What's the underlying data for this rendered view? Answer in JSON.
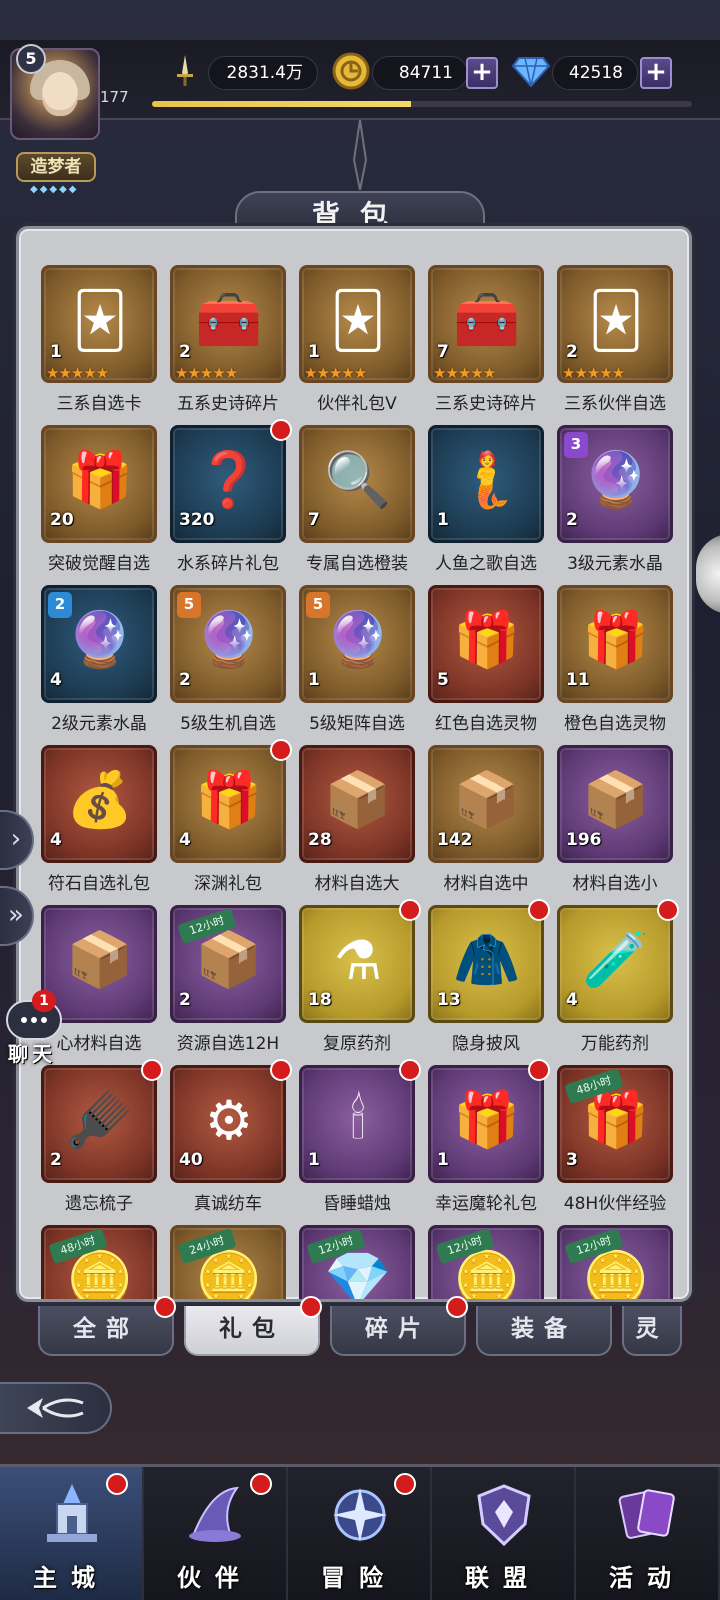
{
  "player": {
    "level": "5",
    "exp": "177",
    "exp_progress": 0.48,
    "title": "造梦者"
  },
  "resources": {
    "power": "2831.4万",
    "gold": "84711",
    "diamond": "42518"
  },
  "bag": {
    "title": "背包",
    "items": [
      {
        "label": "三系自选卡",
        "qty": "1",
        "bg": "brown",
        "icon": "card-icon",
        "glyph": "🃏",
        "stars": "★★★★★",
        "dot": false
      },
      {
        "label": "五系史诗碎片",
        "qty": "2",
        "bg": "brown",
        "icon": "chest-icon",
        "glyph": "🧰",
        "stars": "★★★★★",
        "dot": false
      },
      {
        "label": "伙伴礼包V",
        "qty": "1",
        "bg": "brown",
        "icon": "card-icon",
        "glyph": "🃏",
        "stars": "★★★★★",
        "dot": false
      },
      {
        "label": "三系史诗碎片",
        "qty": "7",
        "bg": "brown",
        "icon": "chest-icon",
        "glyph": "🧰",
        "stars": "★★★★★",
        "dot": false
      },
      {
        "label": "三系伙伴自选",
        "qty": "2",
        "bg": "brown",
        "icon": "card-icon",
        "glyph": "🃏",
        "stars": "★★★★★",
        "dot": false
      },
      {
        "label": "突破觉醒自选",
        "qty": "20",
        "bg": "brown",
        "icon": "gift-box-icon",
        "glyph": "🎁",
        "stars": "",
        "dot": false
      },
      {
        "label": "水系碎片礼包",
        "qty": "320",
        "bg": "blue",
        "icon": "mystery-shard-icon",
        "glyph": "❓",
        "stars": "",
        "dot": true
      },
      {
        "label": "专属自选橙装",
        "qty": "7",
        "bg": "brown",
        "icon": "magnifier-icon",
        "glyph": "🔍",
        "stars": "",
        "dot": false
      },
      {
        "label": "人鱼之歌自选",
        "qty": "1",
        "bg": "blue",
        "icon": "mermaid-portrait-icon",
        "glyph": "🧜",
        "stars": "",
        "dot": false
      },
      {
        "label": "3级元素水晶",
        "qty": "2",
        "bg": "purple",
        "icon": "crystal-ball-icon",
        "glyph": "🔮",
        "stars": "",
        "dot": false,
        "tier": "3",
        "tier_class": "t3"
      },
      {
        "label": "2级元素水晶",
        "qty": "4",
        "bg": "blue",
        "icon": "crystal-ball-icon",
        "glyph": "🔮",
        "stars": "",
        "dot": false,
        "tier": "2",
        "tier_class": "t2"
      },
      {
        "label": "5级生机自选",
        "qty": "2",
        "bg": "brown",
        "icon": "crystal-ball-icon",
        "glyph": "🔮",
        "stars": "",
        "dot": false,
        "tier": "5",
        "tier_class": "t5"
      },
      {
        "label": "5级矩阵自选",
        "qty": "1",
        "bg": "brown",
        "icon": "crystal-ball-icon",
        "glyph": "🔮",
        "stars": "",
        "dot": false,
        "tier": "5",
        "tier_class": "t5"
      },
      {
        "label": "红色自选灵物",
        "qty": "5",
        "bg": "red",
        "icon": "gift-box-icon",
        "glyph": "🎁",
        "stars": "",
        "dot": false
      },
      {
        "label": "橙色自选灵物",
        "qty": "11",
        "bg": "brown",
        "icon": "gift-box-icon",
        "glyph": "🎁",
        "stars": "",
        "dot": false
      },
      {
        "label": "符石自选礼包",
        "qty": "4",
        "bg": "red",
        "icon": "pouch-icon",
        "glyph": "💰",
        "stars": "",
        "dot": false
      },
      {
        "label": "深渊礼包",
        "qty": "4",
        "bg": "brown",
        "icon": "gift-box-icon",
        "glyph": "🎁",
        "stars": "",
        "dot": true
      },
      {
        "label": "材料自选大",
        "qty": "28",
        "bg": "red",
        "icon": "material-box-icon",
        "glyph": "📦",
        "stars": "",
        "dot": false
      },
      {
        "label": "材料自选中",
        "qty": "142",
        "bg": "brown",
        "icon": "material-box-icon",
        "glyph": "📦",
        "stars": "",
        "dot": false
      },
      {
        "label": "材料自选小",
        "qty": "196",
        "bg": "purple",
        "icon": "material-box-icon",
        "glyph": "📦",
        "stars": "",
        "dot": false
      },
      {
        "label": "心材料自选",
        "qty": "",
        "bg": "purple",
        "icon": "material-box-icon",
        "glyph": "📦",
        "stars": "",
        "dot": false
      },
      {
        "label": "资源自选12H",
        "qty": "2",
        "bg": "purple",
        "icon": "material-box-icon",
        "glyph": "📦",
        "stars": "",
        "dot": false,
        "hours": "12小时"
      },
      {
        "label": "复原药剂",
        "qty": "18",
        "bg": "yellow",
        "icon": "potion-icon",
        "glyph": "⚗",
        "stars": "",
        "dot": true
      },
      {
        "label": "隐身披风",
        "qty": "13",
        "bg": "yellow",
        "icon": "cloak-icon",
        "glyph": "🧥",
        "stars": "",
        "dot": true
      },
      {
        "label": "万能药剂",
        "qty": "4",
        "bg": "yellow",
        "icon": "potion-icon",
        "glyph": "🧪",
        "stars": "",
        "dot": true
      },
      {
        "label": "遗忘梳子",
        "qty": "2",
        "bg": "red",
        "icon": "comb-icon",
        "glyph": "🪮",
        "stars": "",
        "dot": true
      },
      {
        "label": "真诚纺车",
        "qty": "40",
        "bg": "red",
        "icon": "spinning-wheel-icon",
        "glyph": "⚙",
        "stars": "",
        "dot": true
      },
      {
        "label": "昏睡蜡烛",
        "qty": "1",
        "bg": "purple",
        "icon": "candle-icon",
        "glyph": "🕯",
        "stars": "",
        "dot": true
      },
      {
        "label": "幸运魔轮礼包",
        "qty": "1",
        "bg": "purple",
        "icon": "gift-box-icon",
        "glyph": "🎁",
        "stars": "",
        "dot": true
      },
      {
        "label": "48H伙伴经验",
        "qty": "3",
        "bg": "red",
        "icon": "exp-box-icon",
        "glyph": "🎁",
        "stars": "",
        "dot": false,
        "hours": "48小时"
      },
      {
        "label": "",
        "qty": "",
        "bg": "red",
        "icon": "gold-pile-icon",
        "glyph": "🪙",
        "stars": "",
        "dot": false,
        "hours": "48小时"
      },
      {
        "label": "",
        "qty": "",
        "bg": "brown",
        "icon": "gold-pile-icon",
        "glyph": "🪙",
        "stars": "",
        "dot": false,
        "hours": "24小时"
      },
      {
        "label": "",
        "qty": "",
        "bg": "purple",
        "icon": "exp-box-icon",
        "glyph": "💎",
        "stars": "",
        "dot": false,
        "hours": "12小时"
      },
      {
        "label": "",
        "qty": "",
        "bg": "purple",
        "icon": "gold-pile-icon",
        "glyph": "🪙",
        "stars": "",
        "dot": false,
        "hours": "12小时"
      },
      {
        "label": "",
        "qty": "",
        "bg": "purple",
        "icon": "gold-pile-icon",
        "glyph": "🪙",
        "stars": "",
        "dot": false,
        "hours": "12小时"
      }
    ]
  },
  "tabs": [
    {
      "label": "全部",
      "active": false,
      "dot": true
    },
    {
      "label": "礼包",
      "active": true,
      "dot": true
    },
    {
      "label": "碎片",
      "active": false,
      "dot": true
    },
    {
      "label": "装备",
      "active": false,
      "dot": false
    },
    {
      "label": "灵",
      "active": false,
      "dot": false
    }
  ],
  "chat": {
    "label": "聊天",
    "badge": "1"
  },
  "nav": [
    {
      "label": "主城",
      "icon": "castle-icon",
      "active": true,
      "dot": true
    },
    {
      "label": "伙伴",
      "icon": "wizard-hat-icon",
      "active": false,
      "dot": true
    },
    {
      "label": "冒险",
      "icon": "compass-star-icon",
      "active": false,
      "dot": true
    },
    {
      "label": "联盟",
      "icon": "alliance-shield-icon",
      "active": false,
      "dot": false
    },
    {
      "label": "活动",
      "icon": "cards-icon",
      "active": false,
      "dot": false
    }
  ],
  "colors": {
    "accent_red": "#d41c1c",
    "panel": "#c8c9cd",
    "star": "#f39a24"
  }
}
